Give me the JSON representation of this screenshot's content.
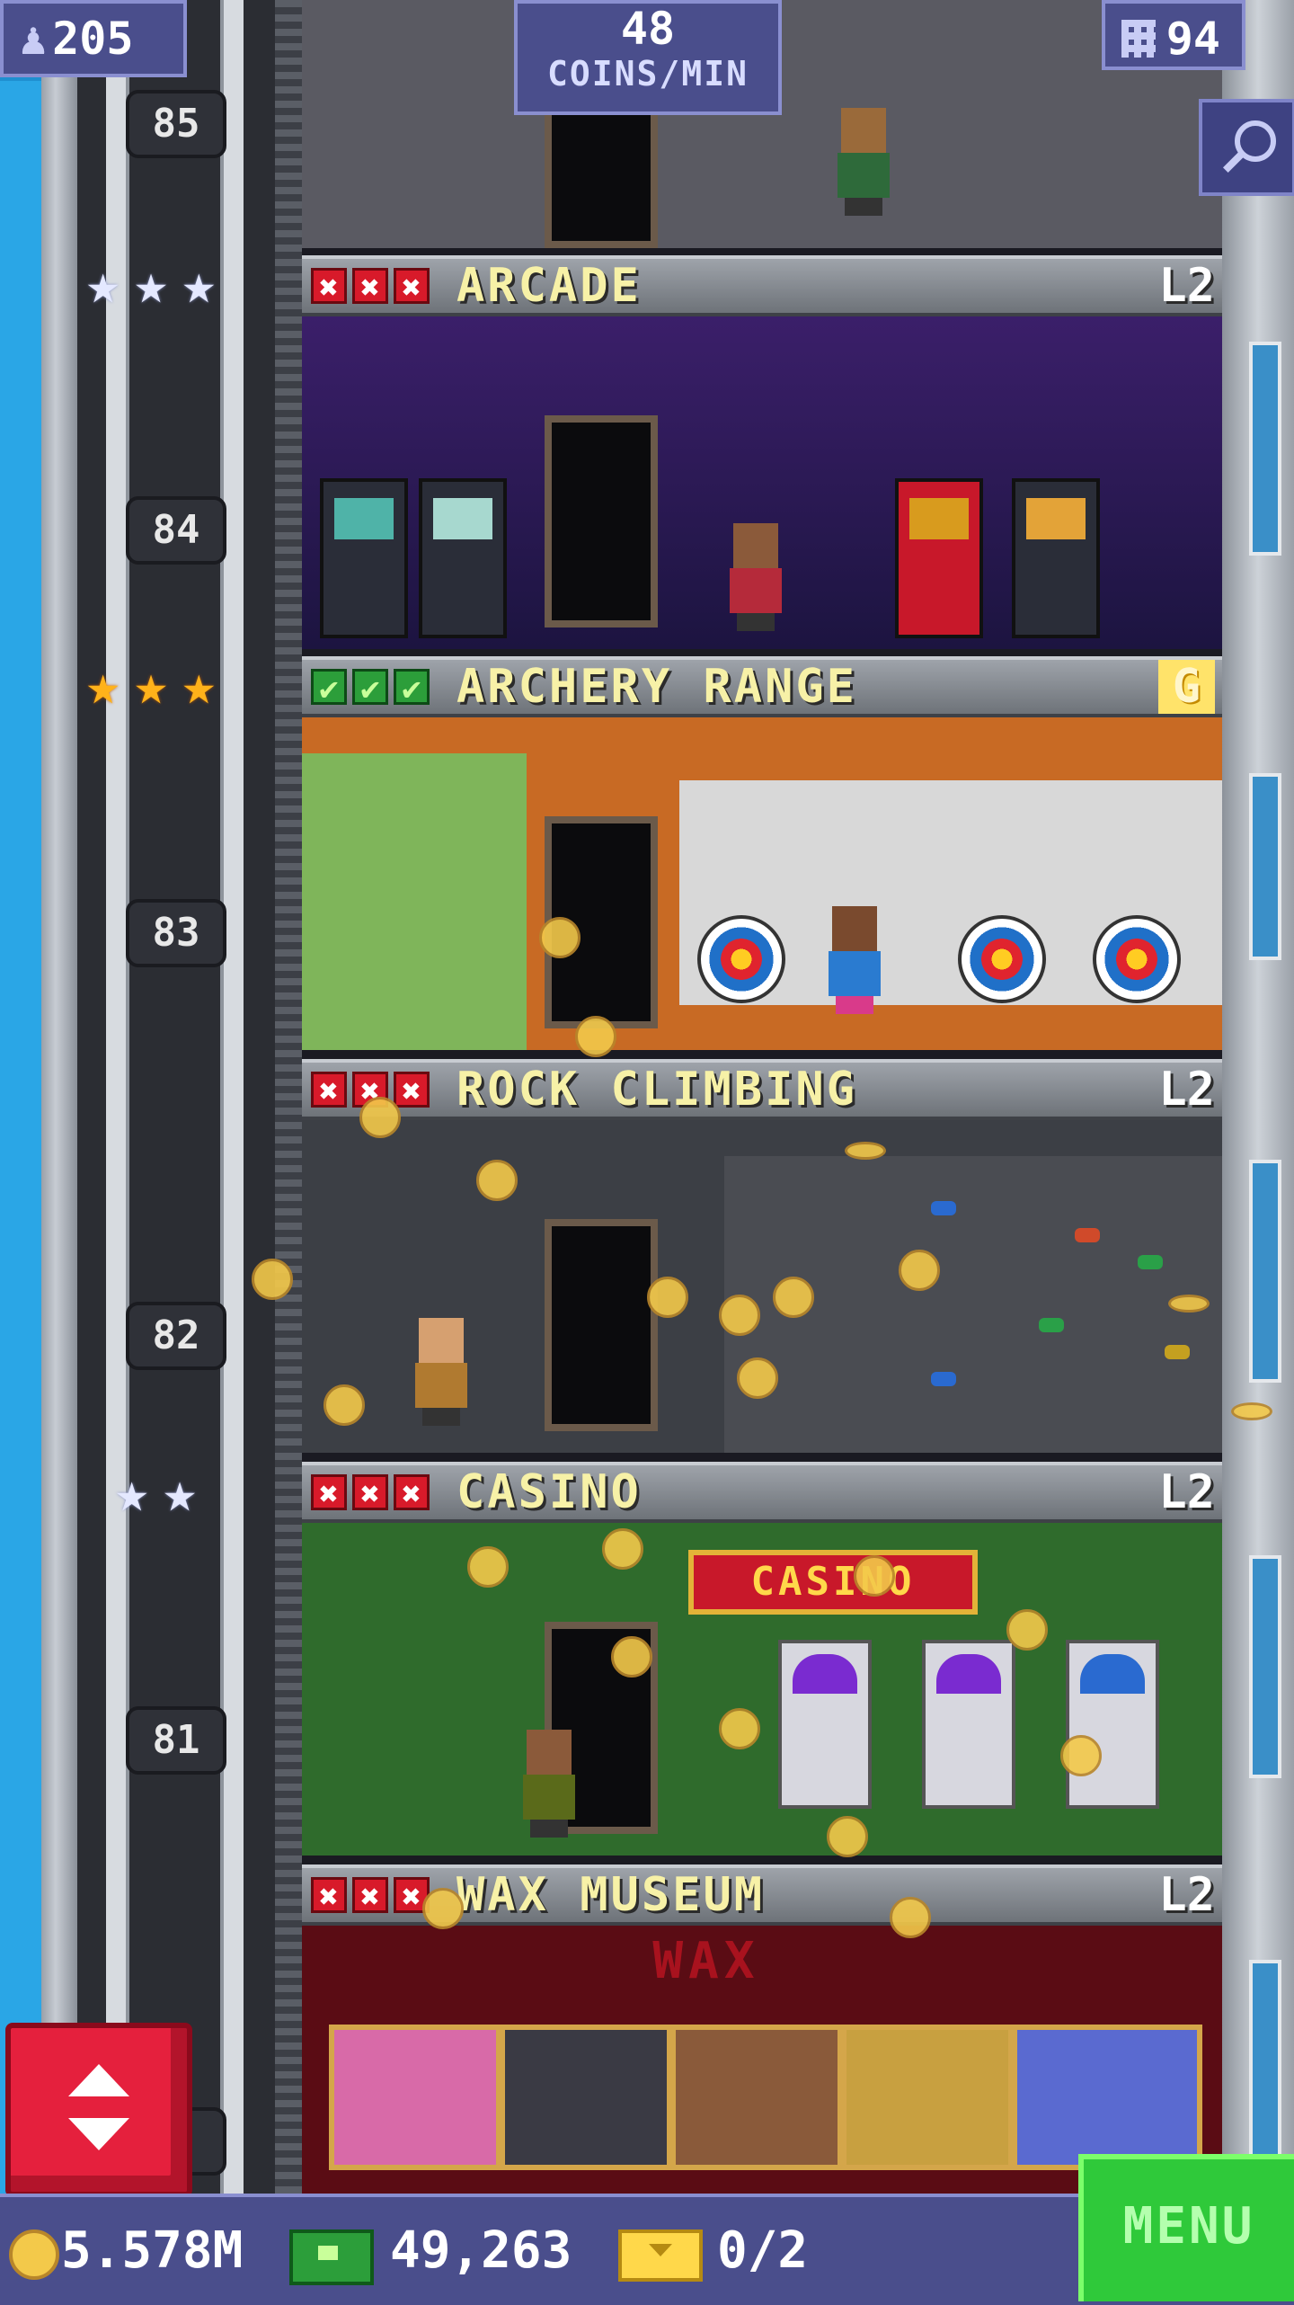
{
  "hud": {
    "population": "205",
    "rate_value": "48",
    "rate_label": "COINS/MIN",
    "floors": "94"
  },
  "floors": [
    {
      "number": "85",
      "name": "ARCADE",
      "level": "L2",
      "stars": "silver",
      "marks": [
        "x",
        "x",
        "x"
      ]
    },
    {
      "number": "84",
      "name": "ARCHERY RANGE",
      "level": "G",
      "stars": "gold",
      "marks": [
        "ok",
        "ok",
        "ok"
      ]
    },
    {
      "number": "83",
      "name": "ROCK CLIMBING",
      "level": "L2",
      "stars": "none",
      "marks": [
        "x",
        "x",
        "x"
      ]
    },
    {
      "number": "82",
      "name": "CASINO",
      "level": "L2",
      "stars": "silver2",
      "marks": [
        "x",
        "x",
        "x"
      ]
    },
    {
      "number": "81",
      "name": "WAX MUSEUM",
      "level": "L2",
      "stars": "none",
      "marks": [
        "x",
        "x",
        "x"
      ]
    }
  ],
  "signs": {
    "casino": "CASINO",
    "wax": "WAX"
  },
  "partial_floor_number": "0",
  "bottom": {
    "coins": "5.578M",
    "bux": "49,263",
    "tickets": "0/2",
    "menu": "MENU"
  },
  "colors": {
    "hud_bg": "#4a4e8c",
    "menu_green": "#2fc93a",
    "elevator_red": "#e5203d",
    "header_text": "#f7f1a7"
  },
  "icons": [
    "population-icon",
    "floors-icon",
    "search-icon",
    "coin-icon",
    "bux-icon",
    "ticket-icon",
    "elevator-arrows-icon"
  ]
}
